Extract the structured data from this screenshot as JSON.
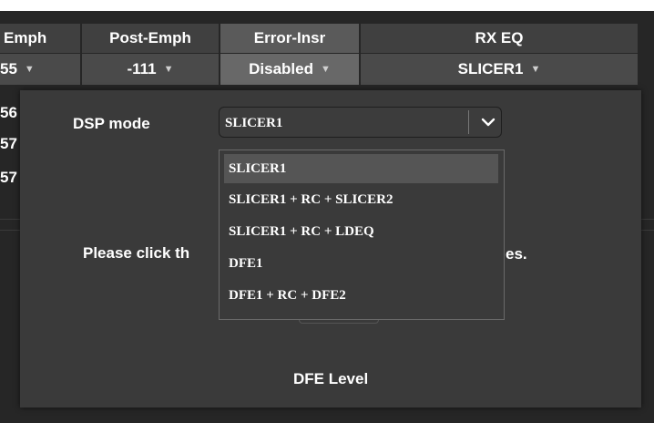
{
  "table": {
    "headers": [
      "Emph",
      "Post-Emph",
      "Error-Insr",
      "RX EQ"
    ],
    "row": [
      "55",
      "-111",
      "Disabled",
      "SLICER1"
    ],
    "left_values": [
      "56",
      "57",
      "57"
    ]
  },
  "dialog": {
    "dsp_label": "DSP mode",
    "dsp_value": "SLICER1",
    "message_left": "Please click th",
    "message_right": "es.",
    "dfe_label": "DFE Level"
  },
  "dropdown": {
    "options": [
      "SLICER1",
      "SLICER1 + RC + SLICER2",
      "SLICER1 + RC + LDEQ",
      "DFE1",
      "DFE1 + RC + DFE2"
    ],
    "selected_index": 0
  }
}
